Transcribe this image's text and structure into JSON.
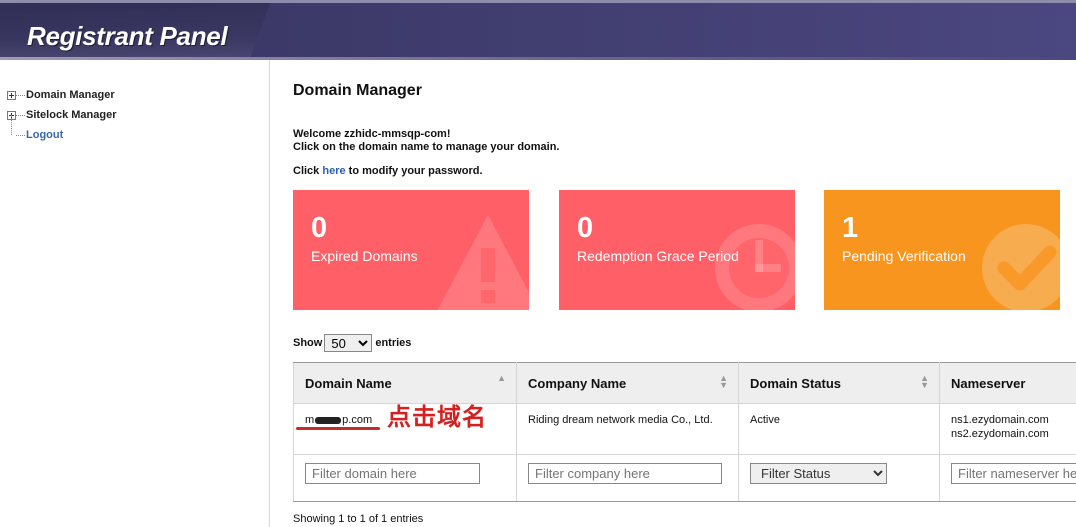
{
  "header": {
    "title": "Registrant Panel"
  },
  "sidebar": {
    "items": [
      {
        "label": "Domain Manager"
      },
      {
        "label": "Sitelock Manager"
      },
      {
        "label": "Logout"
      }
    ]
  },
  "main": {
    "title": "Domain Manager",
    "welcome_line1": "Welcome zzhidc-mmsqp-com!",
    "welcome_line2": "Click on the domain name to manage your domain.",
    "pwd_prefix": "Click ",
    "pwd_link": "here",
    "pwd_suffix": " to modify your password."
  },
  "cards": [
    {
      "count": "0",
      "label": "Expired Domains",
      "color": "#ff5f66"
    },
    {
      "count": "0",
      "label": "Redemption Grace Period",
      "color": "#ff5f66"
    },
    {
      "count": "1",
      "label": "Pending Verification",
      "color": "#f7951f"
    }
  ],
  "entries": {
    "show_label": "Show",
    "value": "50",
    "suffix": "entries"
  },
  "table": {
    "columns": [
      "Domain Name",
      "Company Name",
      "Domain Status",
      "Nameserver"
    ],
    "row": {
      "domain_start": "m",
      "domain_end": "p.com",
      "company": "Riding dream network media Co., Ltd.",
      "status": "Active",
      "ns1": "ns1.ezydomain.com",
      "ns2": "ns2.ezydomain.com"
    },
    "filters": {
      "domain_placeholder": "Filter domain here",
      "company_placeholder": "Filter company here",
      "status_value": "Filter Status",
      "nameserver_placeholder": "Filter nameserver here"
    }
  },
  "annotation": "点击域名",
  "footer": "Showing 1 to 1 of 1 entries",
  "icons": [
    "warning-icon",
    "clock-icon",
    "check-icon",
    "sort-icon",
    "expand-icon"
  ]
}
